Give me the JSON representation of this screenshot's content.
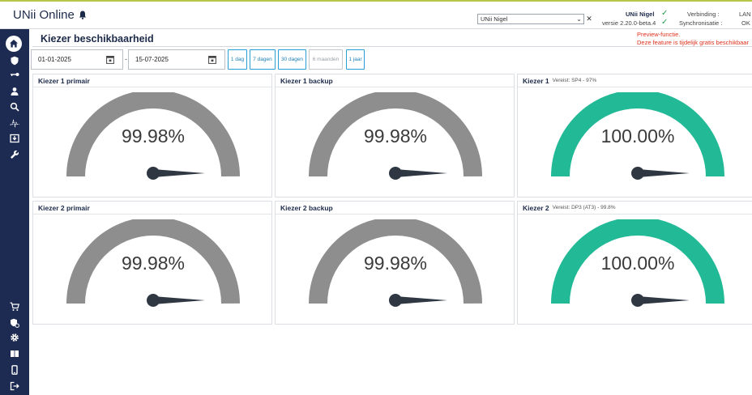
{
  "app": {
    "title": "UNii Online",
    "site_select": "UNii Nigel",
    "close_symbol": "✕",
    "site_name": "UNii Nigel",
    "version": "versie 2.20.0-beta.4",
    "status_check_symbol": "✓",
    "connection_label": "Verbinding :",
    "connection_value": "LAN",
    "sync_label": "Synchronisatie :",
    "sync_value": "OK"
  },
  "page": {
    "title": "Kiezer beschikbaarheid",
    "preview_line1": "Preview-functie.",
    "preview_line2": "Deze feature is tijdelijk gratis beschikbaar"
  },
  "filters": {
    "date_from": "01-01-2025",
    "date_separator": "-",
    "date_to": "15-07-2025",
    "ranges": [
      {
        "label": "1 dag",
        "enabled": true
      },
      {
        "label": "7 dagen",
        "enabled": true
      },
      {
        "label": "30 dagen",
        "enabled": true
      },
      {
        "label": "6 maanden",
        "enabled": false
      },
      {
        "label": "1 jaar",
        "enabled": true
      }
    ]
  },
  "sidebar": {
    "icons": [
      "home-icon",
      "shield-icon",
      "key-icon",
      "user-icon",
      "search-icon",
      "activity-icon",
      "download-icon",
      "wrench-icon",
      "cart-icon",
      "shield-settings-icon",
      "gear-icon",
      "book-icon",
      "phone-icon",
      "logout-icon"
    ]
  },
  "colors": {
    "sidebar": "#1d2b52",
    "gauge_gray": "#8e8e8e",
    "gauge_green": "#21b996",
    "needle": "#2f3743",
    "accent_blue": "#2a9fd6",
    "warning_red": "#e0301e"
  },
  "cards": [
    {
      "title": "Kiezer 1 primair",
      "subtitle": "",
      "value_text": "99.98%",
      "value": 99.98,
      "color": "gray"
    },
    {
      "title": "Kiezer 1 backup",
      "subtitle": "",
      "value_text": "99.98%",
      "value": 99.98,
      "color": "gray"
    },
    {
      "title": "Kiezer 1",
      "subtitle": "Vereist: SP4 - 97%",
      "value_text": "100.00%",
      "value": 100.0,
      "color": "green"
    },
    {
      "title": "Kiezer 2 primair",
      "subtitle": "",
      "value_text": "99.98%",
      "value": 99.98,
      "color": "gray"
    },
    {
      "title": "Kiezer 2 backup",
      "subtitle": "",
      "value_text": "99.98%",
      "value": 99.98,
      "color": "gray"
    },
    {
      "title": "Kiezer 2",
      "subtitle": "Vereist: DP3 (AT3) - 99.8%",
      "value_text": "100.00%",
      "value": 100.0,
      "color": "green"
    }
  ]
}
